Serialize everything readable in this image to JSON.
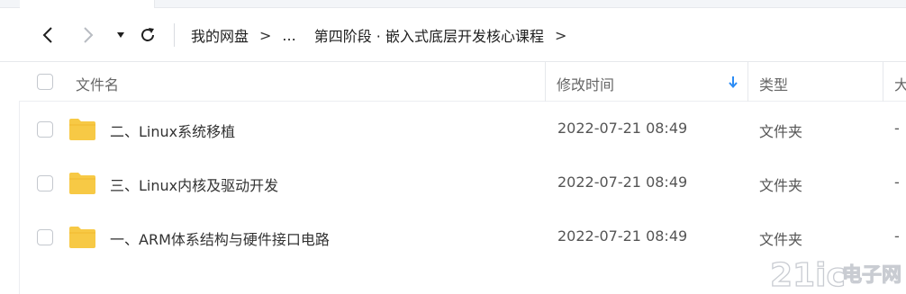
{
  "nav": {
    "back_icon": "chevron-left-icon",
    "forward_icon": "chevron-right-icon",
    "dropdown_icon": "caret-down-icon",
    "refresh_icon": "refresh-icon",
    "breadcrumb": [
      "我的网盘",
      "...",
      "第四阶段 · 嵌入式底层开发核心课程"
    ],
    "breadcrumb_separator": ">"
  },
  "columns": {
    "name": "文件名",
    "modified": "修改时间",
    "type": "类型",
    "size": "大"
  },
  "sort": {
    "column": "修改时间",
    "direction": "descending",
    "icon": "arrow-down-icon"
  },
  "files": [
    {
      "name": "二、Linux系统移植",
      "modified": "2022-07-21 08:49",
      "type": "文件夹",
      "size": "-",
      "icon": "folder-icon"
    },
    {
      "name": "三、Linux内核及驱动开发",
      "modified": "2022-07-21 08:49",
      "type": "文件夹",
      "size": "-",
      "icon": "folder-icon"
    },
    {
      "name": "一、ARM体系结构与硬件接口电路",
      "modified": "2022-07-21 08:49",
      "type": "文件夹",
      "size": "-",
      "icon": "folder-icon"
    }
  ],
  "watermark": {
    "brand": "21ic",
    "text": "电子网"
  },
  "colors": {
    "folder": "#F7C945",
    "sort_arrow": "#2B8CF5",
    "watermark": "#B9BDC4"
  }
}
